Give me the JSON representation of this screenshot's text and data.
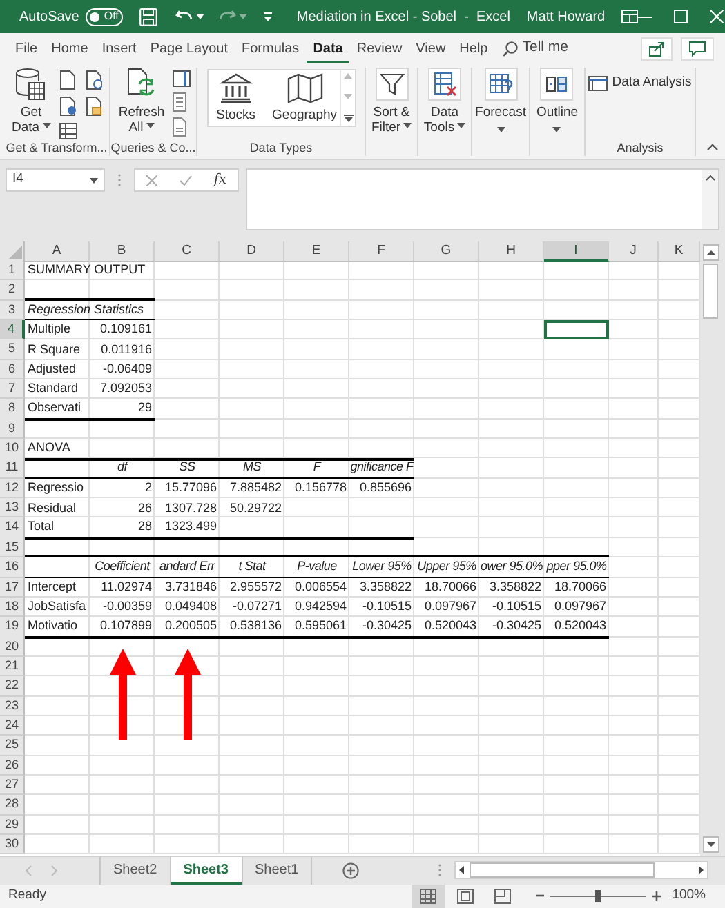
{
  "title_bar": {
    "autosave": {
      "label": "AutoSave",
      "state": "Off",
      "on": false
    },
    "redo_disabled": true,
    "title": "Mediation in Excel - Sobel  -  Excel",
    "user": "Matt Howard"
  },
  "tabs": [
    {
      "label": "File",
      "selected": false
    },
    {
      "label": "Home",
      "selected": false
    },
    {
      "label": "Insert",
      "selected": false
    },
    {
      "label": "Page Layout",
      "selected": false
    },
    {
      "label": "Formulas",
      "selected": false
    },
    {
      "label": "Data",
      "selected": true
    },
    {
      "label": "Review",
      "selected": false
    },
    {
      "label": "View",
      "selected": false
    },
    {
      "label": "Help",
      "selected": false
    }
  ],
  "tell_me": {
    "label": "Tell me"
  },
  "ribbon": {
    "buttons": [
      {
        "lines": [
          "Get",
          "Data"
        ],
        "dropdown": true
      },
      {
        "lines": [
          "Refresh",
          "All"
        ],
        "dropdown": true
      },
      {
        "lines": [
          "Stocks"
        ],
        "dropdown": false
      },
      {
        "lines": [
          "Geography"
        ],
        "dropdown": false
      },
      {
        "lines": [
          "Sort &",
          "Filter"
        ],
        "dropdown": true
      },
      {
        "lines": [
          "Data",
          "Tools"
        ],
        "dropdown": true
      },
      {
        "lines": [
          "Forecast"
        ],
        "dropdown": true
      },
      {
        "lines": [
          "Outline"
        ],
        "dropdown": true
      },
      {
        "lines": [
          "Data Analysis"
        ],
        "dropdown": false
      }
    ],
    "groups": [
      {
        "label": "Get & Transform..."
      },
      {
        "label": "Queries & Co..."
      },
      {
        "label": "Data Types"
      },
      {
        "label": "Analysis"
      }
    ]
  },
  "formula_bar": {
    "name_box": "I4",
    "function_label": "fx"
  },
  "grid": {
    "columns": [
      {
        "label": "A",
        "selected": false
      },
      {
        "label": "B",
        "selected": false
      },
      {
        "label": "C",
        "selected": false
      },
      {
        "label": "D",
        "selected": false
      },
      {
        "label": "E",
        "selected": false
      },
      {
        "label": "F",
        "selected": false
      },
      {
        "label": "G",
        "selected": false
      },
      {
        "label": "H",
        "selected": false
      },
      {
        "label": "I",
        "selected": true
      },
      {
        "label": "J",
        "selected": false
      },
      {
        "label": "K",
        "selected": false
      }
    ],
    "rows": [
      {
        "number": "1",
        "selected": false,
        "cells": [
          {
            "kind": "label",
            "text": "SUMMARY OUTPUT"
          }
        ]
      },
      {
        "number": "2",
        "selected": false,
        "cells": [
          {
            "kind": "empty",
            "ruled": true,
            "heavy": true
          },
          {
            "kind": "empty",
            "ruled": true,
            "heavy": true
          }
        ]
      },
      {
        "number": "3",
        "selected": false,
        "cells": [
          {
            "kind": "caption",
            "text": "Regression Statistics",
            "ruled": true,
            "heavy": false
          },
          {
            "kind": "empty",
            "ruled": true,
            "heavy": false
          }
        ]
      },
      {
        "number": "4",
        "selected": true,
        "cells": [
          {
            "kind": "label",
            "text": "Multiple"
          },
          {
            "kind": "number",
            "text": "0.109161"
          }
        ]
      },
      {
        "number": "5",
        "selected": false,
        "cells": [
          {
            "kind": "label",
            "text": "R Square"
          },
          {
            "kind": "number",
            "text": "0.011916"
          }
        ]
      },
      {
        "number": "6",
        "selected": false,
        "cells": [
          {
            "kind": "label",
            "text": "Adjusted"
          },
          {
            "kind": "number",
            "text": "-0.06409"
          }
        ]
      },
      {
        "number": "7",
        "selected": false,
        "cells": [
          {
            "kind": "label",
            "text": "Standard"
          },
          {
            "kind": "number",
            "text": "7.092053"
          }
        ]
      },
      {
        "number": "8",
        "selected": false,
        "cells": [
          {
            "kind": "label",
            "text": "Observati",
            "ruled": true,
            "heavy": true
          },
          {
            "kind": "number",
            "text": "29",
            "ruled": true,
            "heavy": true
          }
        ]
      },
      {
        "number": "9",
        "selected": false
      },
      {
        "number": "10",
        "selected": false,
        "cells": [
          {
            "kind": "label",
            "text": "ANOVA",
            "ruled": true,
            "heavy": true
          },
          {
            "kind": "empty",
            "ruled": true,
            "heavy": true
          },
          {
            "kind": "empty",
            "ruled": true,
            "heavy": true
          },
          {
            "kind": "empty",
            "ruled": true,
            "heavy": true
          },
          {
            "kind": "empty",
            "ruled": true,
            "heavy": true
          },
          {
            "kind": "empty",
            "ruled": true,
            "heavy": true
          }
        ]
      },
      {
        "number": "11",
        "selected": false,
        "cells": [
          {
            "kind": "empty",
            "ruled": true,
            "heavy": false
          },
          {
            "kind": "heading",
            "text": "df",
            "ruled": true,
            "heavy": false
          },
          {
            "kind": "heading",
            "text": "SS",
            "ruled": true,
            "heavy": false
          },
          {
            "kind": "heading",
            "text": "MS",
            "ruled": true,
            "heavy": false
          },
          {
            "kind": "heading",
            "text": "F",
            "ruled": true,
            "heavy": false
          },
          {
            "kind": "heading",
            "text": "gnificance F",
            "ruled": true,
            "heavy": false
          }
        ]
      },
      {
        "number": "12",
        "selected": false,
        "cells": [
          {
            "kind": "label",
            "text": "Regressio"
          },
          {
            "kind": "number",
            "text": "2"
          },
          {
            "kind": "number",
            "text": "15.77096"
          },
          {
            "kind": "number",
            "text": "7.885482"
          },
          {
            "kind": "number",
            "text": "0.156778"
          },
          {
            "kind": "number",
            "text": "0.855696"
          }
        ]
      },
      {
        "number": "13",
        "selected": false,
        "cells": [
          {
            "kind": "label",
            "text": "Residual"
          },
          {
            "kind": "number",
            "text": "26"
          },
          {
            "kind": "number",
            "text": "1307.728"
          },
          {
            "kind": "number",
            "text": "50.29722"
          }
        ]
      },
      {
        "number": "14",
        "selected": false,
        "cells": [
          {
            "kind": "label",
            "text": "Total",
            "ruled": true,
            "heavy": true
          },
          {
            "kind": "number",
            "text": "28",
            "ruled": true,
            "heavy": true
          },
          {
            "kind": "number",
            "text": "1323.499",
            "ruled": true,
            "heavy": true
          },
          {
            "kind": "empty",
            "ruled": true,
            "heavy": true
          },
          {
            "kind": "empty",
            "ruled": true,
            "heavy": true
          },
          {
            "kind": "empty",
            "ruled": true,
            "heavy": true
          }
        ]
      },
      {
        "number": "15",
        "selected": false,
        "cells": [
          {
            "kind": "empty",
            "ruled": true,
            "heavy": true
          },
          {
            "kind": "empty",
            "ruled": true,
            "heavy": true
          },
          {
            "kind": "empty",
            "ruled": true,
            "heavy": true
          },
          {
            "kind": "empty",
            "ruled": true,
            "heavy": true
          },
          {
            "kind": "empty",
            "ruled": true,
            "heavy": true
          },
          {
            "kind": "empty",
            "ruled": true,
            "heavy": true
          },
          {
            "kind": "empty",
            "ruled": true,
            "heavy": true
          },
          {
            "kind": "empty",
            "ruled": true,
            "heavy": true
          },
          {
            "kind": "empty",
            "ruled": true,
            "heavy": true
          }
        ]
      },
      {
        "number": "16",
        "selected": false,
        "cells": [
          {
            "kind": "empty",
            "ruled": true,
            "heavy": false
          },
          {
            "kind": "heading",
            "text": "Coefficient",
            "ruled": true,
            "heavy": false
          },
          {
            "kind": "heading",
            "text": "andard Err",
            "ruled": true,
            "heavy": false
          },
          {
            "kind": "heading",
            "text": "t Stat",
            "ruled": true,
            "heavy": false
          },
          {
            "kind": "heading",
            "text": "P-value",
            "ruled": true,
            "heavy": false
          },
          {
            "kind": "heading",
            "text": "Lower 95%",
            "ruled": true,
            "heavy": false
          },
          {
            "kind": "heading",
            "text": "Upper 95%",
            "ruled": true,
            "heavy": false
          },
          {
            "kind": "heading",
            "text": "ower 95.0%",
            "ruled": true,
            "heavy": false
          },
          {
            "kind": "heading",
            "text": "pper 95.0%",
            "ruled": true,
            "heavy": false
          }
        ]
      },
      {
        "number": "17",
        "selected": false,
        "cells": [
          {
            "kind": "label",
            "text": "Intercept"
          },
          {
            "kind": "number",
            "text": "11.02974"
          },
          {
            "kind": "number",
            "text": "3.731846"
          },
          {
            "kind": "number",
            "text": "2.955572"
          },
          {
            "kind": "number",
            "text": "0.006554"
          },
          {
            "kind": "number",
            "text": "3.358822"
          },
          {
            "kind": "number",
            "text": "18.70066"
          },
          {
            "kind": "number",
            "text": "3.358822"
          },
          {
            "kind": "number",
            "text": "18.70066"
          }
        ]
      },
      {
        "number": "18",
        "selected": false,
        "cells": [
          {
            "kind": "label",
            "text": "JobSatisfa"
          },
          {
            "kind": "number",
            "text": "-0.00359"
          },
          {
            "kind": "number",
            "text": "0.049408"
          },
          {
            "kind": "number",
            "text": "-0.07271"
          },
          {
            "kind": "number",
            "text": "0.942594"
          },
          {
            "kind": "number",
            "text": "-0.10515"
          },
          {
            "kind": "number",
            "text": "0.097967"
          },
          {
            "kind": "number",
            "text": "-0.10515"
          },
          {
            "kind": "number",
            "text": "0.097967"
          }
        ]
      },
      {
        "number": "19",
        "selected": false,
        "cells": [
          {
            "kind": "label",
            "text": "Motivatio",
            "ruled": true,
            "heavy": true
          },
          {
            "kind": "number",
            "text": "0.107899",
            "ruled": true,
            "heavy": true
          },
          {
            "kind": "number",
            "text": "0.200505",
            "ruled": true,
            "heavy": true
          },
          {
            "kind": "number",
            "text": "0.538136",
            "ruled": true,
            "heavy": true
          },
          {
            "kind": "number",
            "text": "0.595061",
            "ruled": true,
            "heavy": true
          },
          {
            "kind": "number",
            "text": "-0.30425",
            "ruled": true,
            "heavy": true
          },
          {
            "kind": "number",
            "text": "0.520043",
            "ruled": true,
            "heavy": true
          },
          {
            "kind": "number",
            "text": "-0.30425",
            "ruled": true,
            "heavy": true
          },
          {
            "kind": "number",
            "text": "0.520043",
            "ruled": true,
            "heavy": true
          }
        ]
      },
      {
        "number": "20",
        "selected": false
      },
      {
        "number": "21",
        "selected": false
      },
      {
        "number": "22",
        "selected": false
      },
      {
        "number": "23",
        "selected": false
      },
      {
        "number": "24",
        "selected": false
      },
      {
        "number": "25",
        "selected": false
      },
      {
        "number": "26",
        "selected": false
      },
      {
        "number": "27",
        "selected": false
      },
      {
        "number": "28",
        "selected": false
      },
      {
        "number": "29",
        "selected": false
      },
      {
        "number": "30",
        "selected": false
      }
    ]
  },
  "sheet_tabs": [
    {
      "label": "Sheet2",
      "selected": false
    },
    {
      "label": "Sheet3",
      "selected": true
    },
    {
      "label": "Sheet1",
      "selected": false
    }
  ],
  "status_bar": {
    "status": "Ready",
    "views": [
      {
        "selected": true
      },
      {
        "selected": false
      },
      {
        "selected": false
      }
    ],
    "zoom": {
      "level": 0.5,
      "reading": "100%"
    }
  }
}
